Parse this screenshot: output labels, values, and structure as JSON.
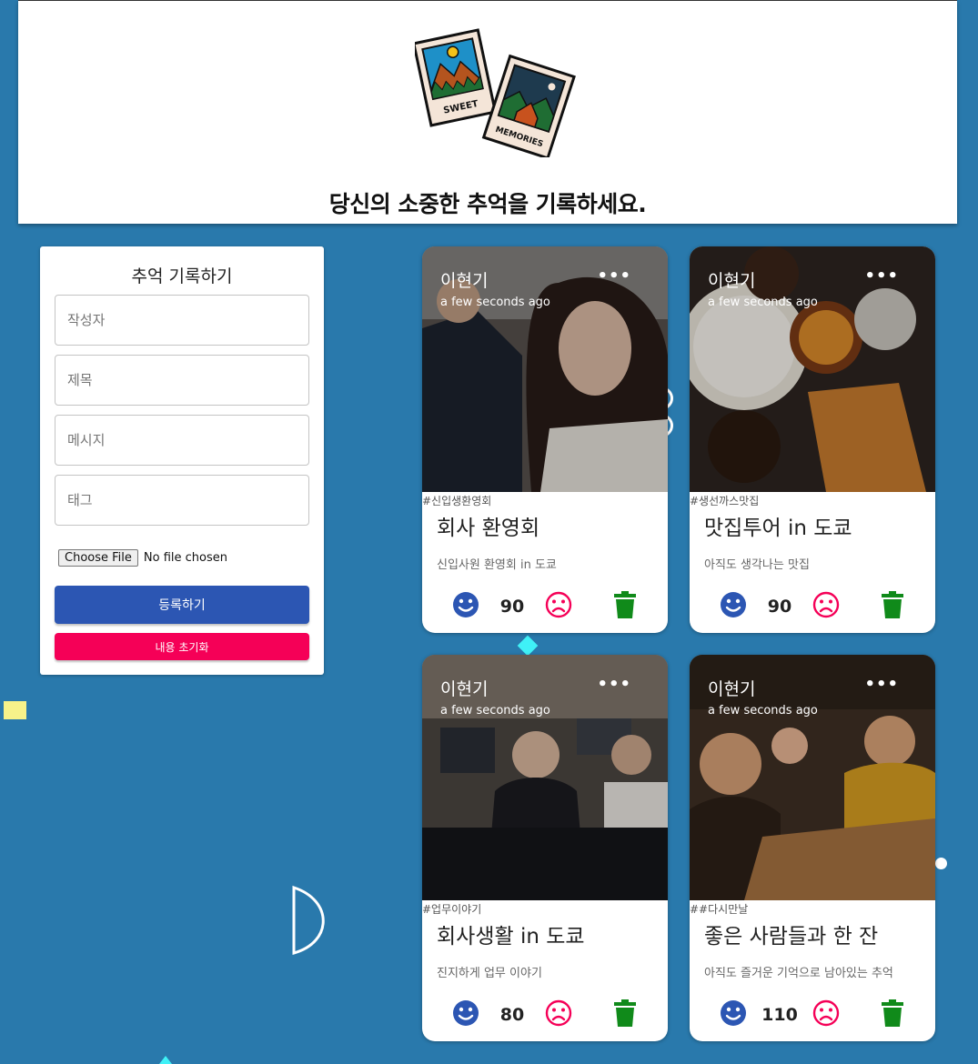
{
  "header": {
    "logo_text_1": "SWEET",
    "logo_text_2": "MEMORIES",
    "title": "당신의 소중한 추억을 기록하세요."
  },
  "form": {
    "title": "추억 기록하기",
    "creator_placeholder": "작성자",
    "title_placeholder": "제목",
    "message_placeholder": "메시지",
    "tags_placeholder": "태그",
    "file_button": "Choose File",
    "file_status": "No file chosen",
    "submit_label": "등록하기",
    "clear_label": "내용 초기화"
  },
  "posts": [
    {
      "author": "이현기",
      "time": "a few seconds ago",
      "more": "•••",
      "tags": "#신입생환영회",
      "title": "회사 환영회",
      "message": "신입사원 환영회 in 도쿄",
      "likes": "90"
    },
    {
      "author": "이현기",
      "time": "a few seconds ago",
      "more": "•••",
      "tags": "#생선까스맛집",
      "title": "맛집투어 in 도쿄",
      "message": "아직도 생각나는 맛집",
      "likes": "90"
    },
    {
      "author": "이현기",
      "time": "a few seconds ago",
      "more": "•••",
      "tags": "#업무이야기",
      "title": "회사생활 in 도쿄",
      "message": "진지하게 업무 이야기",
      "likes": "80"
    },
    {
      "author": "이현기",
      "time": "a few seconds ago",
      "more": "•••",
      "tags": "##다시만날",
      "title": "좋은 사람들과 한 잔",
      "message": "아직도 즐거운 기억으로 남아있는 추억",
      "likes": "110"
    }
  ],
  "colors": {
    "background": "#2979ac",
    "primary": "#2c56b3",
    "secondary": "#f50057",
    "like": "#2c56b3",
    "dislike": "#f50057",
    "delete": "#108a1a"
  },
  "icons": {
    "like": "smile-icon",
    "dislike": "frown-icon",
    "delete": "trash-icon",
    "more": "more-horizontal-icon"
  }
}
